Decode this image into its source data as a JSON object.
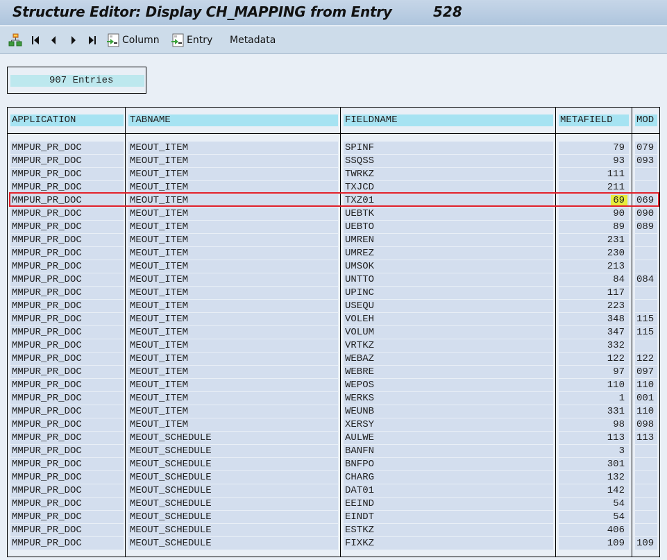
{
  "window": {
    "title": "Structure Editor: Display CH_MAPPING from Entry",
    "entry_number": "528"
  },
  "toolbar": {
    "items": [
      {
        "name": "hierarchy",
        "icon": "hierarchy-icon",
        "label": ""
      },
      {
        "name": "first",
        "icon": "first-page-icon",
        "label": ""
      },
      {
        "name": "previous",
        "icon": "previous-icon",
        "label": ""
      },
      {
        "name": "next",
        "icon": "next-icon",
        "label": ""
      },
      {
        "name": "last",
        "icon": "last-page-icon",
        "label": ""
      },
      {
        "name": "column",
        "icon": "column-choose-icon",
        "label": "Column"
      },
      {
        "name": "entry",
        "icon": "entry-choose-icon",
        "label": "Entry"
      },
      {
        "name": "metadata",
        "icon": "",
        "label": "Metadata"
      }
    ]
  },
  "entries_count": "907 Entries",
  "table": {
    "columns": [
      "APPLICATION",
      "TABNAME",
      "FIELDNAME",
      "METAFIELD",
      "MOD"
    ],
    "selected_row_index": 4,
    "highlighted_cell": {
      "row": 4,
      "column": "METAFIELD"
    },
    "colors": {
      "selection_frame": "#e0202a",
      "cell_highlight": "#e6ec3c",
      "header_bg": "#a6e3f2",
      "cell_bg": "#d3deee"
    },
    "rows": [
      {
        "application": "MMPUR_PR_DOC",
        "tabname": "MEOUT_ITEM",
        "fieldname": "SPINF",
        "metafield": "79",
        "mod": "079"
      },
      {
        "application": "MMPUR_PR_DOC",
        "tabname": "MEOUT_ITEM",
        "fieldname": "SSQSS",
        "metafield": "93",
        "mod": "093"
      },
      {
        "application": "MMPUR_PR_DOC",
        "tabname": "MEOUT_ITEM",
        "fieldname": "TWRKZ",
        "metafield": "111",
        "mod": ""
      },
      {
        "application": "MMPUR_PR_DOC",
        "tabname": "MEOUT_ITEM",
        "fieldname": "TXJCD",
        "metafield": "211",
        "mod": ""
      },
      {
        "application": "MMPUR_PR_DOC",
        "tabname": "MEOUT_ITEM",
        "fieldname": "TXZ01",
        "metafield": "69",
        "mod": "069"
      },
      {
        "application": "MMPUR_PR_DOC",
        "tabname": "MEOUT_ITEM",
        "fieldname": "UEBTK",
        "metafield": "90",
        "mod": "090"
      },
      {
        "application": "MMPUR_PR_DOC",
        "tabname": "MEOUT_ITEM",
        "fieldname": "UEBTO",
        "metafield": "89",
        "mod": "089"
      },
      {
        "application": "MMPUR_PR_DOC",
        "tabname": "MEOUT_ITEM",
        "fieldname": "UMREN",
        "metafield": "231",
        "mod": ""
      },
      {
        "application": "MMPUR_PR_DOC",
        "tabname": "MEOUT_ITEM",
        "fieldname": "UMREZ",
        "metafield": "230",
        "mod": ""
      },
      {
        "application": "MMPUR_PR_DOC",
        "tabname": "MEOUT_ITEM",
        "fieldname": "UMSOK",
        "metafield": "213",
        "mod": ""
      },
      {
        "application": "MMPUR_PR_DOC",
        "tabname": "MEOUT_ITEM",
        "fieldname": "UNTTO",
        "metafield": "84",
        "mod": "084"
      },
      {
        "application": "MMPUR_PR_DOC",
        "tabname": "MEOUT_ITEM",
        "fieldname": "UPINC",
        "metafield": "117",
        "mod": ""
      },
      {
        "application": "MMPUR_PR_DOC",
        "tabname": "MEOUT_ITEM",
        "fieldname": "USEQU",
        "metafield": "223",
        "mod": ""
      },
      {
        "application": "MMPUR_PR_DOC",
        "tabname": "MEOUT_ITEM",
        "fieldname": "VOLEH",
        "metafield": "348",
        "mod": "115"
      },
      {
        "application": "MMPUR_PR_DOC",
        "tabname": "MEOUT_ITEM",
        "fieldname": "VOLUM",
        "metafield": "347",
        "mod": "115"
      },
      {
        "application": "MMPUR_PR_DOC",
        "tabname": "MEOUT_ITEM",
        "fieldname": "VRTKZ",
        "metafield": "332",
        "mod": ""
      },
      {
        "application": "MMPUR_PR_DOC",
        "tabname": "MEOUT_ITEM",
        "fieldname": "WEBAZ",
        "metafield": "122",
        "mod": "122"
      },
      {
        "application": "MMPUR_PR_DOC",
        "tabname": "MEOUT_ITEM",
        "fieldname": "WEBRE",
        "metafield": "97",
        "mod": "097"
      },
      {
        "application": "MMPUR_PR_DOC",
        "tabname": "MEOUT_ITEM",
        "fieldname": "WEPOS",
        "metafield": "110",
        "mod": "110"
      },
      {
        "application": "MMPUR_PR_DOC",
        "tabname": "MEOUT_ITEM",
        "fieldname": "WERKS",
        "metafield": "1",
        "mod": "001"
      },
      {
        "application": "MMPUR_PR_DOC",
        "tabname": "MEOUT_ITEM",
        "fieldname": "WEUNB",
        "metafield": "331",
        "mod": "110"
      },
      {
        "application": "MMPUR_PR_DOC",
        "tabname": "MEOUT_ITEM",
        "fieldname": "XERSY",
        "metafield": "98",
        "mod": "098"
      },
      {
        "application": "MMPUR_PR_DOC",
        "tabname": "MEOUT_SCHEDULE",
        "fieldname": "AULWE",
        "metafield": "113",
        "mod": "113"
      },
      {
        "application": "MMPUR_PR_DOC",
        "tabname": "MEOUT_SCHEDULE",
        "fieldname": "BANFN",
        "metafield": "3",
        "mod": ""
      },
      {
        "application": "MMPUR_PR_DOC",
        "tabname": "MEOUT_SCHEDULE",
        "fieldname": "BNFPO",
        "metafield": "301",
        "mod": ""
      },
      {
        "application": "MMPUR_PR_DOC",
        "tabname": "MEOUT_SCHEDULE",
        "fieldname": "CHARG",
        "metafield": "132",
        "mod": ""
      },
      {
        "application": "MMPUR_PR_DOC",
        "tabname": "MEOUT_SCHEDULE",
        "fieldname": "DAT01",
        "metafield": "142",
        "mod": ""
      },
      {
        "application": "MMPUR_PR_DOC",
        "tabname": "MEOUT_SCHEDULE",
        "fieldname": "EEIND",
        "metafield": "54",
        "mod": ""
      },
      {
        "application": "MMPUR_PR_DOC",
        "tabname": "MEOUT_SCHEDULE",
        "fieldname": "EINDT",
        "metafield": "54",
        "mod": ""
      },
      {
        "application": "MMPUR_PR_DOC",
        "tabname": "MEOUT_SCHEDULE",
        "fieldname": "ESTKZ",
        "metafield": "406",
        "mod": ""
      },
      {
        "application": "MMPUR_PR_DOC",
        "tabname": "MEOUT_SCHEDULE",
        "fieldname": "FIXKZ",
        "metafield": "109",
        "mod": "109"
      }
    ]
  }
}
